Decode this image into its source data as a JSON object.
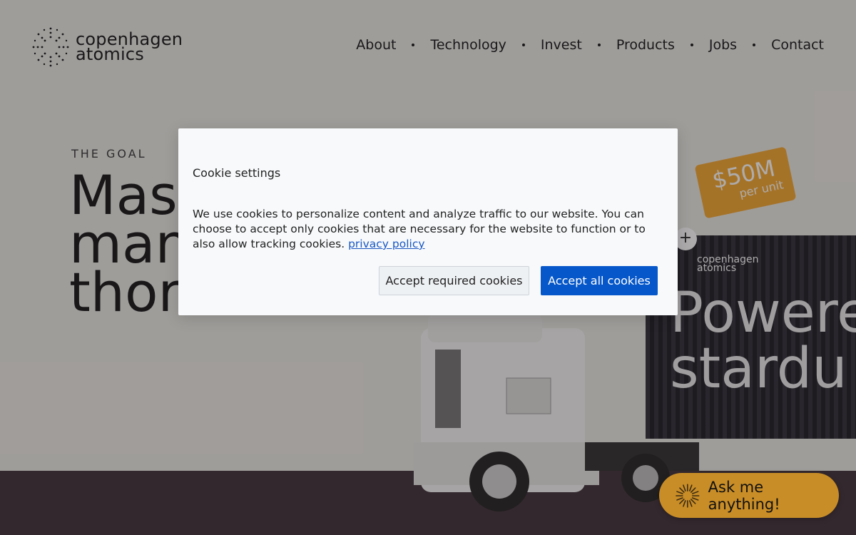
{
  "header": {
    "brand_line1": "copenhagen",
    "brand_line2": "atomics",
    "logo_icon": "starburst-logo-icon",
    "nav": [
      "About",
      "Technology",
      "Invest",
      "Products",
      "Jobs",
      "Contact"
    ]
  },
  "hero": {
    "eyebrow": "THE GOAL",
    "headline_line1": "Mass",
    "headline_line2": "manu",
    "headline_line3": "thori"
  },
  "container": {
    "brand_line1": "copenhagen",
    "brand_line2": "atomics",
    "slogan_line1": "Powere",
    "slogan_line2": "stardu"
  },
  "price_tag": {
    "value": "$50M",
    "note": "per unit"
  },
  "cookie_dialog": {
    "title": "Cookie settings",
    "body": "We use cookies to personalize content and analyze traffic to our website. You can choose to accept only cookies that are necessary for the website to function or to also allow tracking cookies. ",
    "link_label": "privacy policy",
    "btn_required": "Accept required cookies",
    "btn_all": "Accept all cookies"
  },
  "chat": {
    "label": "Ask me anything!",
    "icon": "starburst-icon"
  },
  "colors": {
    "primary_button": "#0657c9",
    "chat_button": "#c98d27",
    "price_tag": "#f2a52a"
  }
}
